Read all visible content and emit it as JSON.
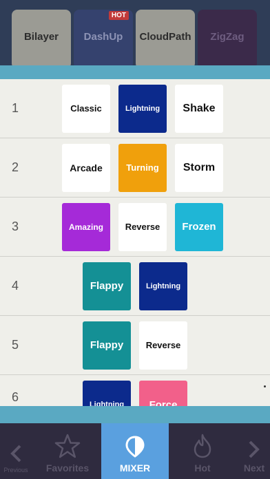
{
  "top_games": [
    {
      "label": "Bilayer",
      "bg": "#9b9b94",
      "fg": "#2c2c2c",
      "hot": false
    },
    {
      "label": "DashUp",
      "bg": "#35426e",
      "fg": "#8d93b5",
      "hot": true
    },
    {
      "label": "CloudPath",
      "bg": "#9b9b94",
      "fg": "#2c2c2c",
      "hot": false
    },
    {
      "label": "ZigZag",
      "bg": "#3b2a4a",
      "fg": "#6e5d80",
      "hot": false
    }
  ],
  "hot_badge": "HOT",
  "rows": [
    {
      "number": "1",
      "tiles": [
        {
          "label": "Classic",
          "bg": "#ffffff",
          "fg": "#111111"
        },
        {
          "label": "Lightning",
          "bg": "#0c2a8c",
          "fg": "#ffffff"
        },
        {
          "label": "Shake",
          "bg": "#ffffff",
          "fg": "#111111"
        }
      ]
    },
    {
      "number": "2",
      "tiles": [
        {
          "label": "Arcade",
          "bg": "#ffffff",
          "fg": "#111111"
        },
        {
          "label": "Turning",
          "bg": "#f0a00c",
          "fg": "#ffffff"
        },
        {
          "label": "Storm",
          "bg": "#ffffff",
          "fg": "#111111"
        }
      ]
    },
    {
      "number": "3",
      "tiles": [
        {
          "label": "Amazing",
          "bg": "#a52ad8",
          "fg": "#ffffff"
        },
        {
          "label": "Reverse",
          "bg": "#ffffff",
          "fg": "#111111"
        },
        {
          "label": "Frozen",
          "bg": "#1fb6d6",
          "fg": "#ffffff"
        }
      ]
    },
    {
      "number": "4",
      "tiles": [
        {
          "label": "Flappy",
          "bg": "#149095",
          "fg": "#ffffff"
        },
        {
          "label": "Lightning",
          "bg": "#0c2a8c",
          "fg": "#ffffff"
        }
      ]
    },
    {
      "number": "5",
      "tiles": [
        {
          "label": "Flappy",
          "bg": "#149095",
          "fg": "#ffffff"
        },
        {
          "label": "Reverse",
          "bg": "#ffffff",
          "fg": "#111111"
        }
      ]
    },
    {
      "number": "6",
      "tiles": [
        {
          "label": "Lightning",
          "bg": "#0c2a8c",
          "fg": "#ffffff"
        },
        {
          "label": "Force",
          "bg": "#f2608a",
          "fg": "#ffffff"
        }
      ]
    }
  ],
  "bottom_nav": {
    "previous": {
      "label": "Previous",
      "icon": "chevron-left-icon"
    },
    "favorites": {
      "label": "Favorites",
      "icon": "star-icon"
    },
    "mixer": {
      "label": "MIXER",
      "icon": "mixer-icon"
    },
    "hot": {
      "label": "Hot",
      "icon": "flame-icon"
    },
    "next": {
      "label": "Next",
      "icon": "chevron-right-icon"
    }
  },
  "colors": {
    "panel_bar": "#5aa9c2",
    "panel_bg": "#efefea",
    "nav_bg": "#2f2b3f",
    "mixer_active": "#5aa0df"
  }
}
